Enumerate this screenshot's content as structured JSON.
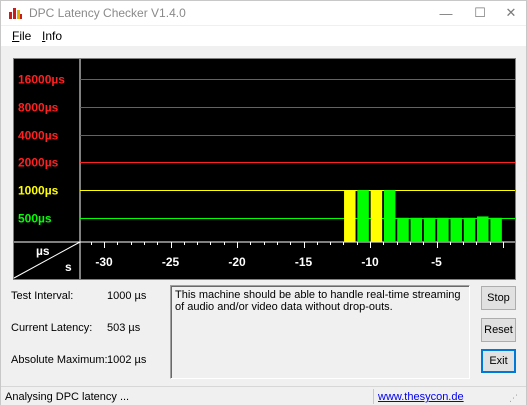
{
  "window": {
    "title": "DPC Latency Checker V1.4.0",
    "controls": {
      "minimize": "—",
      "maximize": "☐",
      "close": "✕"
    }
  },
  "menu": {
    "file_first": "F",
    "file_rest": "ile",
    "info_first": "I",
    "info_rest": "nfo"
  },
  "chart_data": {
    "type": "bar",
    "y_tick_labels": [
      "16000µs",
      "8000µs",
      "4000µs",
      "2000µs",
      "1000µs",
      "500µs"
    ],
    "y_tick_values": [
      16000,
      8000,
      4000,
      2000,
      1000,
      500
    ],
    "y_tick_colors": [
      "#ff2020",
      "#ff2020",
      "#ff2020",
      "#ff2020",
      "#ffff00",
      "#00ff00"
    ],
    "x_tick_labels": [
      "-30",
      "-25",
      "-20",
      "-15",
      "-10",
      "-5"
    ],
    "x_tick_values": [
      -30,
      -25,
      -20,
      -15,
      -10,
      -5
    ],
    "x_unit": "s",
    "y_unit": "µs",
    "grid": true,
    "bars": [
      {
        "t": -11.5,
        "value": 1002,
        "color": "#ffff00"
      },
      {
        "t": -10.5,
        "value": 1002,
        "color": "#00ff00"
      },
      {
        "t": -9.5,
        "value": 1002,
        "color": "#ffff00"
      },
      {
        "t": -8.5,
        "value": 1002,
        "color": "#00ff00"
      },
      {
        "t": -7.5,
        "value": 503,
        "color": "#00ff00"
      },
      {
        "t": -6.5,
        "value": 503,
        "color": "#00ff00"
      },
      {
        "t": -5.5,
        "value": 503,
        "color": "#00ff00"
      },
      {
        "t": -4.5,
        "value": 503,
        "color": "#00ff00"
      },
      {
        "t": -3.5,
        "value": 503,
        "color": "#00ff00"
      },
      {
        "t": -2.5,
        "value": 503,
        "color": "#00ff00"
      },
      {
        "t": -1.5,
        "value": 520,
        "color": "#00ff00"
      },
      {
        "t": -0.5,
        "value": 503,
        "color": "#00ff00"
      }
    ]
  },
  "stats": {
    "test_interval_label": "Test Interval:",
    "test_interval_value": "1000 µs",
    "current_latency_label": "Current Latency:",
    "current_latency_value": "503 µs",
    "absolute_max_label": "Absolute Maximum:",
    "absolute_max_value": "1002 µs"
  },
  "message": "This machine should be able to handle real-time streaming of audio and/or video data without drop-outs.",
  "buttons": {
    "stop": "Stop",
    "reset": "Reset",
    "exit": "Exit"
  },
  "status": {
    "text": "Analysing DPC latency ...",
    "link": "www.thesycon.de"
  }
}
